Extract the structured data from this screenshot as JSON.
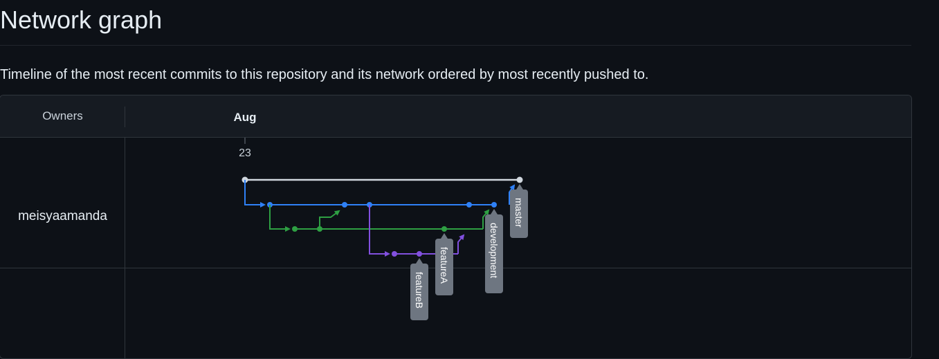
{
  "page": {
    "title": "Network graph",
    "description": "Timeline of the most recent commits to this repository and its network ordered by most recently pushed to."
  },
  "graph": {
    "owners_header": "Owners",
    "month_label": "Aug",
    "day_label": "23",
    "owners": [
      "meisyaamanda"
    ],
    "branch_labels": {
      "master": "master",
      "development": "development",
      "featureA": "featureA",
      "featureB": "featureB"
    }
  },
  "colors": {
    "background": "#0d1117",
    "header_background": "#161b22",
    "master_lane": "#d0d7de",
    "blue_lane": "#2f81f7",
    "green_lane": "#2ea043",
    "purple_lane": "#8250df",
    "label_tag": "#6e7681"
  }
}
